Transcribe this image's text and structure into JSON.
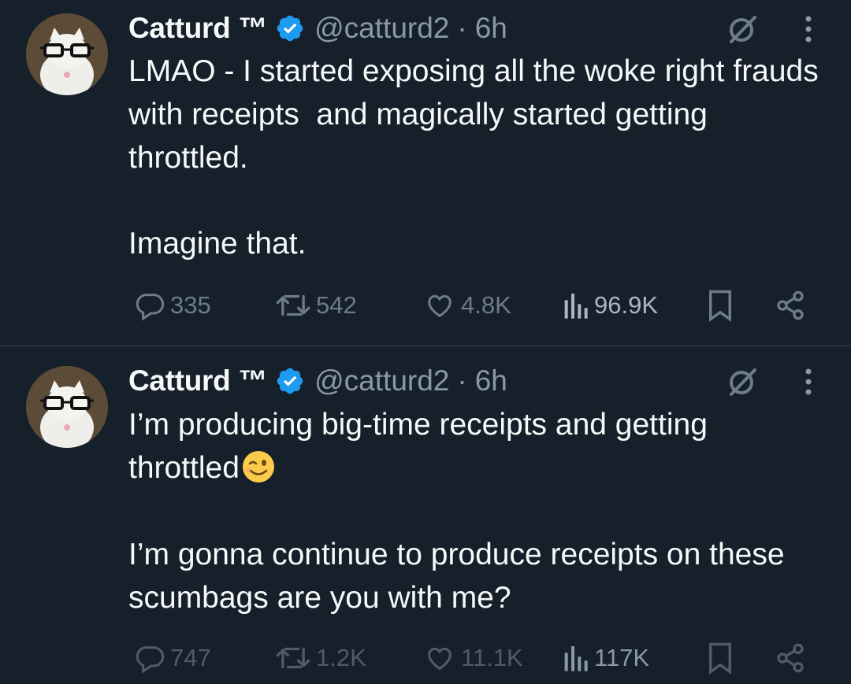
{
  "tweets": [
    {
      "author_name": "Catturd ™",
      "handle": "@catturd2",
      "separator": "·",
      "time": "6h",
      "text_paragraphs": [
        "LMAO - I started exposing all the woke right frauds with receipts  and magically started getting throttled.",
        "Imagine that."
      ],
      "replies": "335",
      "reposts": "542",
      "likes": "4.8K",
      "views": "96.9K"
    },
    {
      "author_name": "Catturd ™",
      "handle": "@catturd2",
      "separator": "·",
      "time": "6h",
      "text_paragraphs": [
        "I’m producing big-time receipts and getting throttled",
        "I’m gonna continue to produce receipts on these scumbags are you with me?"
      ],
      "emoji": "winking-face",
      "replies": "747",
      "reposts": "1.2K",
      "likes": "11.1K",
      "views": "117K"
    }
  ],
  "colors": {
    "background": "#15202b",
    "text": "#f7f9f9",
    "secondary": "#8b98a5",
    "action": "#6e7b88",
    "verified": "#1d9bf0",
    "divider": "#38444d"
  },
  "icons": [
    "avatar-cat",
    "verified-badge-icon",
    "grok-icon",
    "more-vertical-icon",
    "reply-icon",
    "repost-icon",
    "like-icon",
    "views-icon",
    "bookmark-icon",
    "share-icon"
  ]
}
